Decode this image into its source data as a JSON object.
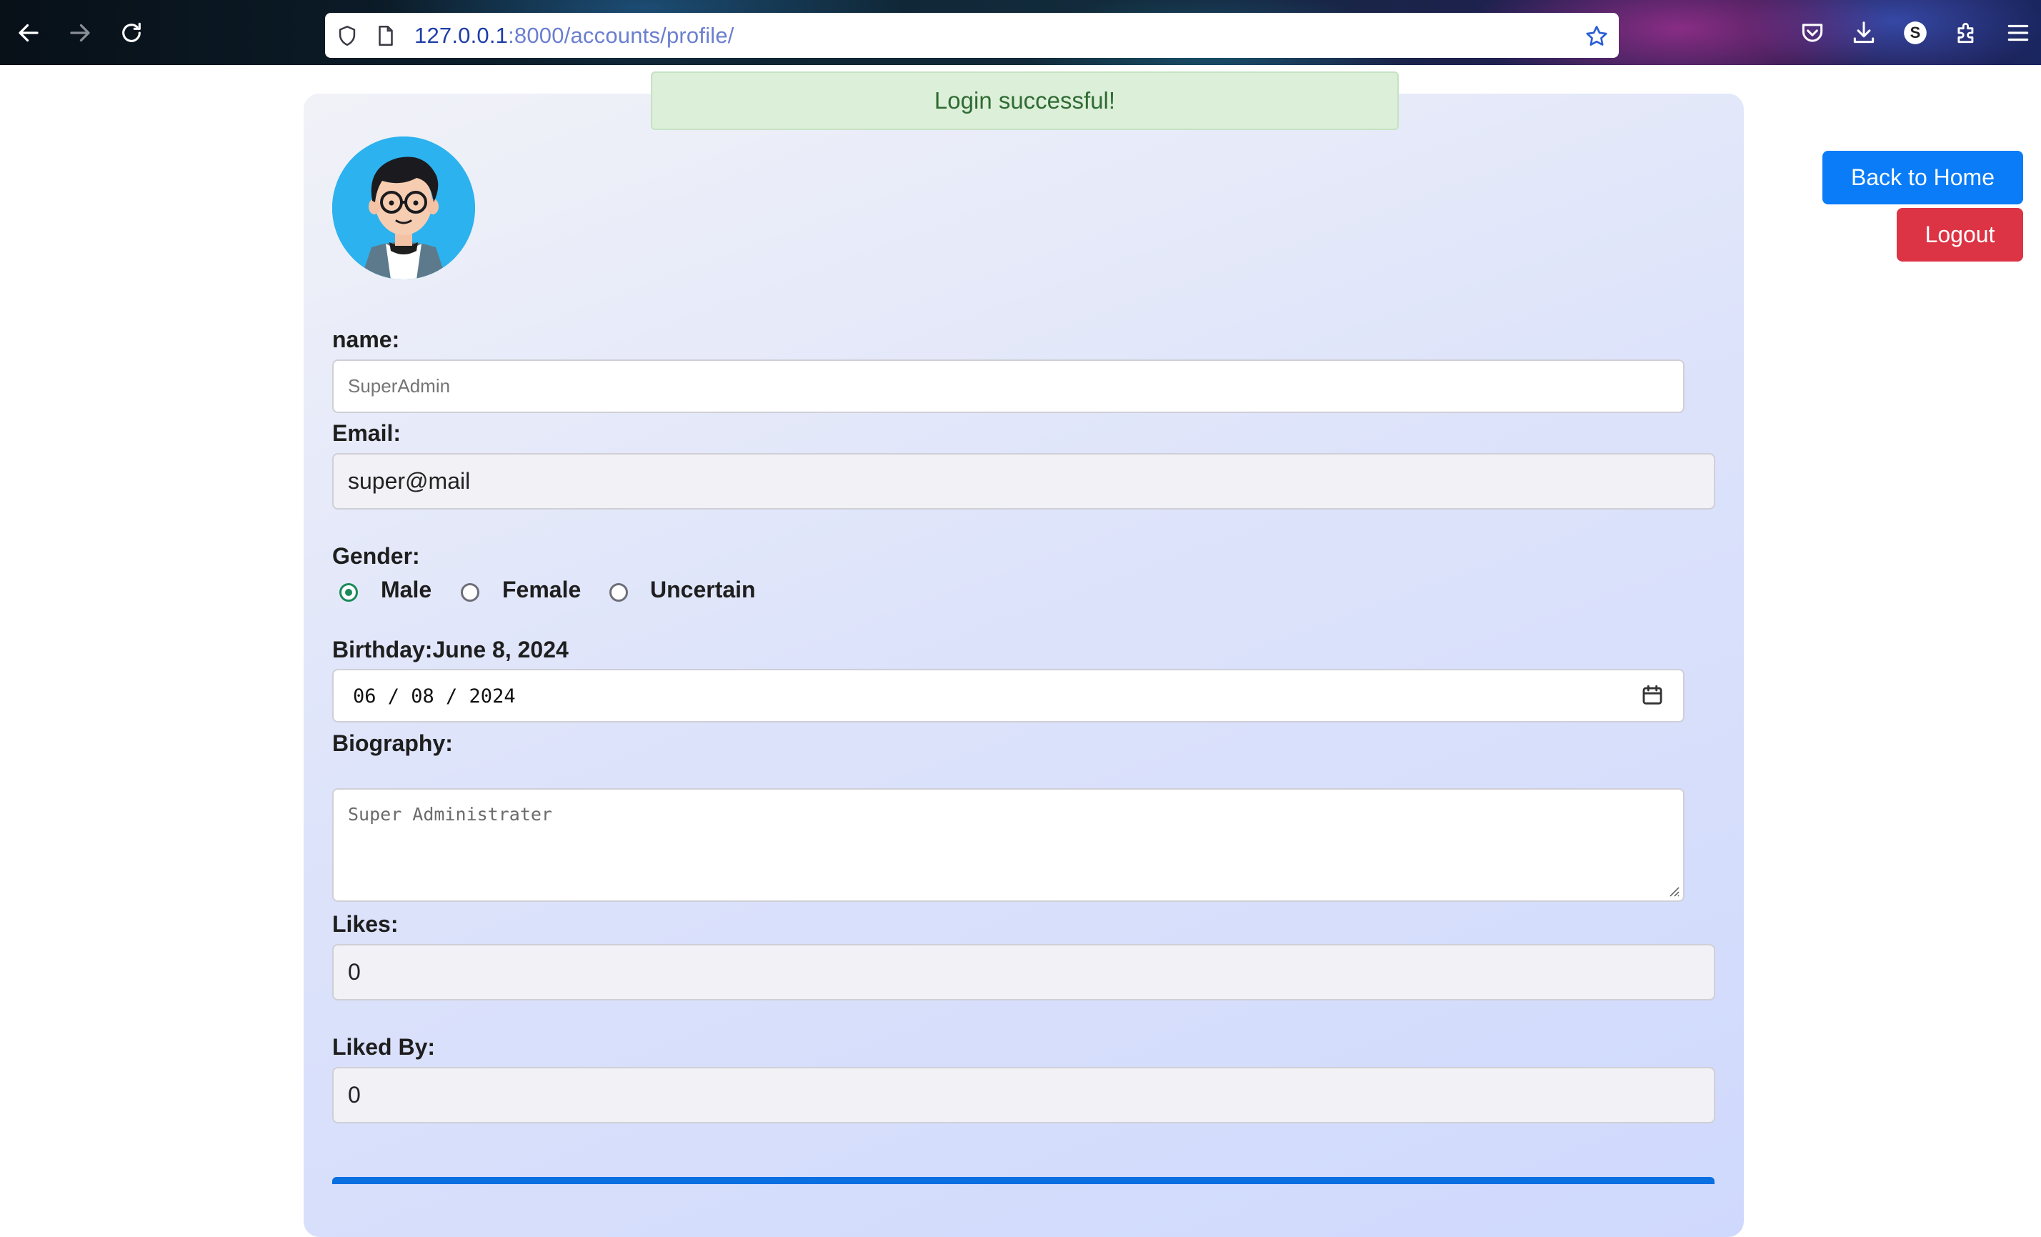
{
  "browser": {
    "url_host": "127.0.0.1",
    "url_path": ":8000/accounts/profile/",
    "profile_initial": "S",
    "icons": {
      "back": "back-arrow-icon",
      "forward": "forward-arrow-icon",
      "reload": "reload-icon",
      "shield": "shield-icon",
      "page": "page-icon",
      "bookmark": "star-icon",
      "pocket": "pocket-icon",
      "downloads": "download-icon",
      "extensions": "puzzle-icon",
      "menu": "hamburger-menu-icon"
    }
  },
  "alert": {
    "message": "Login successful!",
    "color": "#2f6b33"
  },
  "actions": {
    "back_home": "Back to Home",
    "logout": "Logout",
    "back_color": "#0a7cf7",
    "logout_color": "#dc3444"
  },
  "profile": {
    "name_label": "name:",
    "name_placeholder": "SuperAdmin",
    "email_label": "Email:",
    "email_value": "super@mail",
    "gender_label": "Gender:",
    "gender_options": [
      "Male",
      "Female",
      "Uncertain"
    ],
    "gender_selected": "Male",
    "birthday_label": "Birthday:June 8, 2024",
    "birthday_value": "06 / 08 / 2024",
    "biography_label": "Biography:",
    "biography_placeholder": "Super Administrater",
    "likes_label": "Likes:",
    "likes_value": "0",
    "liked_by_label": "Liked By:",
    "liked_by_value": "0"
  }
}
